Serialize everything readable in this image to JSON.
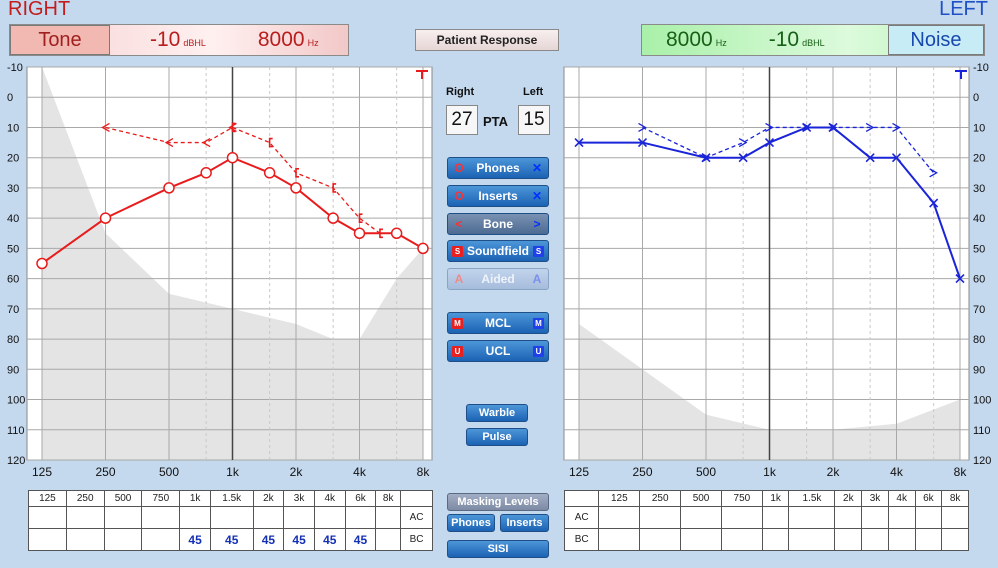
{
  "right": {
    "side_label": "RIGHT",
    "mode_label": "Tone",
    "level": "-10",
    "level_unit": "dBHL",
    "freq": "8000",
    "freq_unit": "Hz"
  },
  "left": {
    "side_label": "LEFT",
    "mode_label": "Noise",
    "level": "-10",
    "level_unit": "dBHL",
    "freq": "8000",
    "freq_unit": "Hz"
  },
  "patient_response_label": "Patient Response",
  "pta": {
    "right_header": "Right",
    "left_header": "Left",
    "label": "PTA",
    "right_value": "27",
    "left_value": "15"
  },
  "transducer_buttons": [
    {
      "label": "Phones",
      "left_sym": "O",
      "right_sym": "✕",
      "state": "active"
    },
    {
      "label": "Inserts",
      "left_sym": "O",
      "right_sym": "✕",
      "state": "active"
    },
    {
      "label": "Bone",
      "left_sym": "<",
      "right_sym": ">",
      "state": "selected"
    },
    {
      "label": "Soundfield",
      "left_sym": "S",
      "right_sym": "S",
      "state": "active"
    },
    {
      "label": "Aided",
      "left_sym": "A",
      "right_sym": "A",
      "state": "disabled"
    }
  ],
  "level_buttons": [
    {
      "label": "MCL",
      "left_sym": "M",
      "right_sym": "M"
    },
    {
      "label": "UCL",
      "left_sym": "U",
      "right_sym": "U"
    }
  ],
  "stim_buttons": {
    "warble": "Warble",
    "pulse": "Pulse"
  },
  "bottom_buttons": {
    "masking_levels": "Masking Levels",
    "phones": "Phones",
    "inserts": "Inserts",
    "sisi": "SISI"
  },
  "mask_table": {
    "headers": [
      "125",
      "250",
      "500",
      "750",
      "1k",
      "1.5k",
      "2k",
      "3k",
      "4k",
      "6k",
      "8k"
    ],
    "ac_label": "AC",
    "bc_label": "BC",
    "right_bc": [
      "",
      "",
      "",
      "",
      "45",
      "45",
      "45",
      "45",
      "45",
      "45",
      ""
    ],
    "right_ac": [
      "",
      "",
      "",
      "",
      "",
      "",
      "",
      "",
      "",
      "",
      ""
    ],
    "left_bc": [
      "",
      "",
      "",
      "",
      "",
      "",
      "",
      "",
      "",
      "",
      ""
    ],
    "left_ac": [
      "",
      "",
      "",
      "",
      "",
      "",
      "",
      "",
      "",
      "",
      ""
    ]
  },
  "colors": {
    "right": "#e81c1c",
    "left": "#1a24d8",
    "shade": "#e4e4e4"
  },
  "chart_data": [
    {
      "type": "line",
      "panel": "right",
      "x_freqs": [
        125,
        250,
        500,
        750,
        1000,
        1500,
        2000,
        3000,
        4000,
        6000,
        8000
      ],
      "x_tick_labels": [
        "125",
        "250",
        "500",
        "1k",
        "2k",
        "4k",
        "8k"
      ],
      "y_tick_labels": [
        "-10",
        "0",
        "10",
        "20",
        "30",
        "40",
        "50",
        "60",
        "70",
        "80",
        "90",
        "100",
        "110",
        "120"
      ],
      "ylim": [
        -10,
        120
      ],
      "y_inverted": true,
      "series": [
        {
          "name": "",
          "kind": "air-conduction",
          "symbol": "circle",
          "style": "solid",
          "points": [
            [
              125,
              55
            ],
            [
              250,
              40
            ],
            [
              500,
              30
            ],
            [
              750,
              25
            ],
            [
              1000,
              20
            ],
            [
              1500,
              25
            ],
            [
              2000,
              30
            ],
            [
              3000,
              40
            ],
            [
              4000,
              45
            ],
            [
              6000,
              45
            ],
            [
              8000,
              50
            ]
          ]
        },
        {
          "name": "",
          "kind": "bone-conduction",
          "symbol": "arrow-left",
          "style": "dashed",
          "points": [
            [
              250,
              10
            ],
            [
              500,
              15
            ],
            [
              750,
              15
            ],
            [
              1000,
              10
            ]
          ]
        },
        {
          "name": "",
          "kind": "masked-bone",
          "symbol": "bracket",
          "style": "dashed",
          "points": [
            [
              1000,
              10
            ],
            [
              1500,
              15
            ],
            [
              2000,
              25
            ],
            [
              3000,
              30
            ],
            [
              4000,
              40
            ],
            [
              5000,
              45
            ]
          ]
        }
      ],
      "shade": [
        [
          125,
          -10
        ],
        [
          250,
          45
        ],
        [
          500,
          65
        ],
        [
          1000,
          70
        ],
        [
          2000,
          75
        ],
        [
          3000,
          80
        ],
        [
          4000,
          80
        ],
        [
          6000,
          60
        ],
        [
          8000,
          50
        ]
      ]
    },
    {
      "type": "line",
      "panel": "left",
      "x_freqs": [
        125,
        250,
        500,
        750,
        1000,
        1500,
        2000,
        3000,
        4000,
        6000,
        8000
      ],
      "x_tick_labels": [
        "125",
        "250",
        "500",
        "1k",
        "2k",
        "4k",
        "8k"
      ],
      "y_tick_labels": [
        "-10",
        "0",
        "10",
        "20",
        "30",
        "40",
        "50",
        "60",
        "70",
        "80",
        "90",
        "100",
        "110",
        "120"
      ],
      "ylim": [
        -10,
        120
      ],
      "y_inverted": true,
      "series": [
        {
          "name": "",
          "kind": "air-conduction",
          "symbol": "x",
          "style": "solid",
          "points": [
            [
              125,
              15
            ],
            [
              250,
              15
            ],
            [
              500,
              20
            ],
            [
              750,
              20
            ],
            [
              1000,
              15
            ],
            [
              1500,
              10
            ],
            [
              2000,
              10
            ],
            [
              3000,
              20
            ],
            [
              4000,
              20
            ],
            [
              6000,
              35
            ],
            [
              8000,
              60
            ]
          ]
        },
        {
          "name": "",
          "kind": "bone-conduction",
          "symbol": "arrow-right",
          "style": "dashed",
          "points": [
            [
              250,
              10
            ],
            [
              500,
              20
            ],
            [
              750,
              15
            ],
            [
              1000,
              10
            ],
            [
              1500,
              10
            ],
            [
              2000,
              10
            ],
            [
              3000,
              10
            ],
            [
              4000,
              10
            ],
            [
              6000,
              25
            ]
          ]
        }
      ],
      "shade": [
        [
          125,
          75
        ],
        [
          250,
          90
        ],
        [
          500,
          105
        ],
        [
          1000,
          110
        ],
        [
          2000,
          110
        ],
        [
          4000,
          108
        ],
        [
          8000,
          100
        ]
      ]
    }
  ]
}
